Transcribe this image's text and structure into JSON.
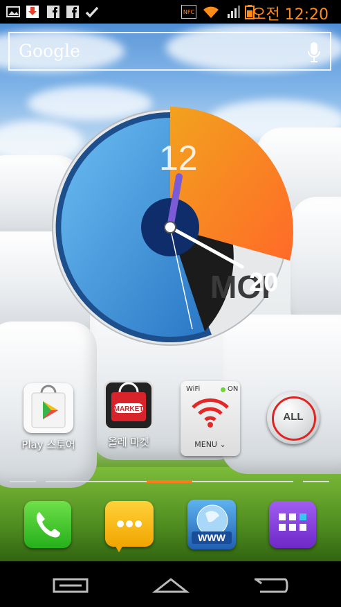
{
  "status_bar": {
    "nfc_label": "NFC",
    "time": "오전 12:20",
    "time_color": "#ff8c1a",
    "left_icons": [
      "gallery-icon",
      "download-icon",
      "facebook-icon",
      "facebook-icon",
      "check-icon"
    ],
    "right_icons": [
      "nfc-icon",
      "wifi-icon",
      "signal-icon",
      "battery-icon"
    ]
  },
  "search": {
    "logo_text": "Google",
    "mic_icon": "microphone-icon"
  },
  "clock_widget": {
    "hour_text": "12",
    "minute_text": "20",
    "brand_text": "MOI",
    "colors": {
      "orange": "#f39a1e",
      "blue": "#4aa3e6",
      "dark": "#1a1a1a"
    }
  },
  "home_apps": [
    {
      "label": "Play 스토어",
      "icon": "play-store-icon"
    },
    {
      "label": "올레 마켓",
      "icon": "olleh-market-icon",
      "icon_text": "MARKET"
    },
    {
      "label": "",
      "icon": "wifi-widget-icon",
      "wifi_label": "WiFi",
      "status": "ON",
      "menu": "MENU"
    },
    {
      "label": "",
      "icon": "all-button-icon",
      "icon_text": "ALL"
    }
  ],
  "dock": [
    {
      "icon": "phone-icon",
      "color": "#3cc82a"
    },
    {
      "icon": "messages-icon",
      "color": "#f5b400"
    },
    {
      "icon": "browser-icon",
      "icon_text": "WWW",
      "color": "#2f7fd1"
    },
    {
      "icon": "apps-drawer-icon",
      "color": "#8a3fd6"
    }
  ],
  "pager": {
    "current_page_fraction": 0.5
  },
  "nav_bar": [
    "menu-icon",
    "home-icon",
    "back-icon"
  ]
}
